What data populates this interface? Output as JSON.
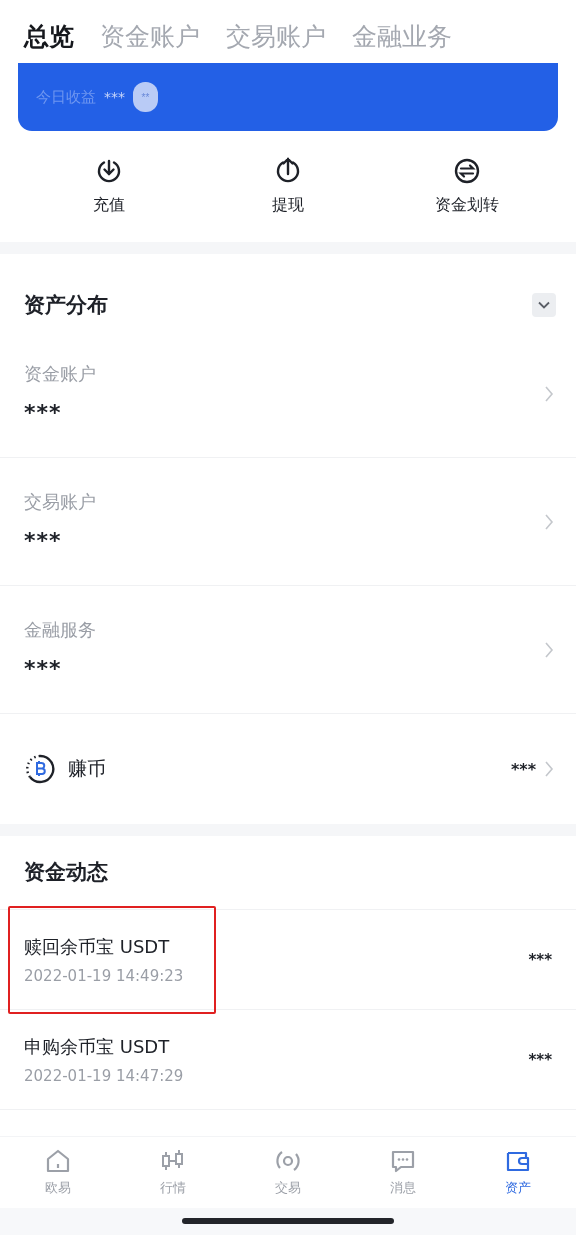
{
  "top_tabs": [
    {
      "label": "总览",
      "selected": true
    },
    {
      "label": "资金账户",
      "selected": false
    },
    {
      "label": "交易账户",
      "selected": false
    },
    {
      "label": "金融业务",
      "selected": false
    }
  ],
  "earnings_card": {
    "label": "今日收益",
    "value": "***",
    "toggle": "**"
  },
  "actions": [
    {
      "kind": "deposit",
      "label": "充值"
    },
    {
      "kind": "withdraw",
      "label": "提现"
    },
    {
      "kind": "transfer",
      "label": "资金划转"
    }
  ],
  "asset_distribution": {
    "title": "资产分布",
    "expanded": false,
    "accounts": [
      {
        "name": "资金账户",
        "value": "***"
      },
      {
        "name": "交易账户",
        "value": "***"
      },
      {
        "name": "金融服务",
        "value": "***"
      }
    ],
    "earn": {
      "name": "赚币",
      "value": "***"
    }
  },
  "fund_activity": {
    "title": "资金动态",
    "items": [
      {
        "title": "赎回余币宝 USDT",
        "time": "2022-01-19 14:49:23",
        "amount": "***",
        "highlighted": true
      },
      {
        "title": "申购余币宝 USDT",
        "time": "2022-01-19 14:47:29",
        "amount": "***",
        "highlighted": false
      }
    ]
  },
  "bottom_nav": [
    {
      "kind": "home",
      "label": "欧易",
      "selected": false
    },
    {
      "kind": "market",
      "label": "行情",
      "selected": false
    },
    {
      "kind": "trade",
      "label": "交易",
      "selected": false
    },
    {
      "kind": "messages",
      "label": "消息",
      "selected": false
    },
    {
      "kind": "assets",
      "label": "资产",
      "selected": true
    }
  ]
}
